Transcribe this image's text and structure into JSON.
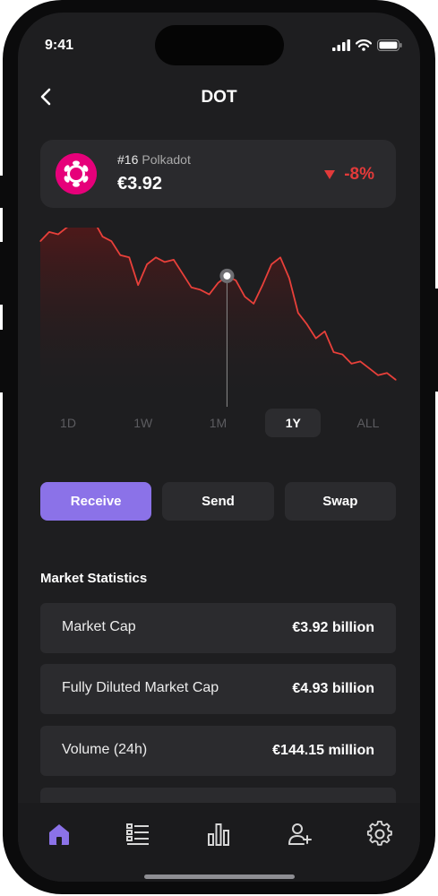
{
  "status_bar": {
    "time": "9:41"
  },
  "header": {
    "title": "DOT",
    "back_icon": "chevron-left-icon"
  },
  "coin": {
    "rank": "#16",
    "name": "Polkadot",
    "price": "€3.92",
    "change": "-8%",
    "change_icon": "triangle-down-icon",
    "brand_color": "#e6007a",
    "negative_color": "#e23a3a"
  },
  "chart_data": {
    "type": "area",
    "title": "",
    "xlabel": "",
    "ylabel": "",
    "x": [
      0,
      1,
      2,
      3,
      4,
      5,
      6,
      7,
      8,
      9,
      10,
      11,
      12,
      13,
      14,
      15,
      16,
      17,
      18,
      19,
      20,
      21,
      22,
      23,
      24,
      25,
      26,
      27,
      28,
      29,
      30,
      31,
      32,
      33,
      34,
      35,
      36,
      37,
      38,
      39,
      40
    ],
    "values": [
      62,
      66,
      65,
      68,
      70,
      69,
      71,
      64,
      62,
      56,
      55,
      43,
      52,
      55,
      53,
      54,
      48,
      42,
      41,
      39,
      44,
      47,
      45,
      38,
      35,
      43,
      52,
      55,
      46,
      31,
      26,
      20,
      23,
      14,
      13,
      9,
      10,
      7,
      4,
      5,
      2
    ],
    "selected_index": 21,
    "line_color": "#e8403a"
  },
  "time_ranges": [
    {
      "label": "1D"
    },
    {
      "label": "1W"
    },
    {
      "label": "1M"
    },
    {
      "label": "1Y",
      "active": true
    },
    {
      "label": "ALL"
    }
  ],
  "actions": {
    "receive": "Receive",
    "send": "Send",
    "swap": "Swap",
    "accent_color": "#8b72e8"
  },
  "market_statistics": {
    "title": "Market Statistics",
    "rows": [
      {
        "label": "Market Cap",
        "value": "€3.92 billion"
      },
      {
        "label": "Fully Diluted Market Cap",
        "value": "€4.93 billion"
      },
      {
        "label": "Volume (24h)",
        "value": "€144.15 million"
      }
    ]
  },
  "tab_bar": {
    "items": [
      "home-icon",
      "list-icon",
      "bar-chart-icon",
      "add-user-icon",
      "gear-icon"
    ],
    "active_color": "#8b72e8"
  }
}
